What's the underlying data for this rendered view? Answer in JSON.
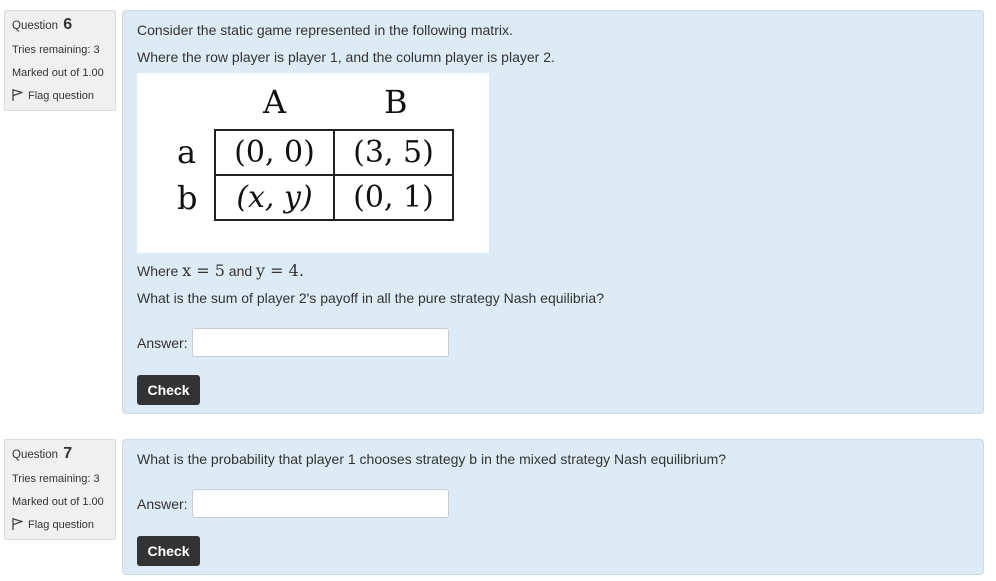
{
  "questions": [
    {
      "label": "Question",
      "number": "6",
      "tries": "Tries remaining: 3",
      "marked": "Marked out of 1.00",
      "flag": "Flag question",
      "intro_1": "Consider the static game represented in the following matrix.",
      "intro_2": "Where the row player is player 1, and the column player is player 2.",
      "matrix": {
        "col_headers": [
          "A",
          "B"
        ],
        "row_headers": [
          "a",
          "b"
        ],
        "cells": [
          [
            "(0, 0)",
            "(3, 5)"
          ],
          [
            "(x, y)",
            "(0, 1)"
          ]
        ]
      },
      "where_prefix": "Where",
      "where_x": "x = 5",
      "where_and": "and",
      "where_y": "y = 4.",
      "prompt": "What is the sum of player 2's payoff in all the pure strategy Nash equilibria?",
      "answer_label": "Answer:",
      "answer_value": "",
      "check_label": "Check"
    },
    {
      "label": "Question",
      "number": "7",
      "tries": "Tries remaining: 3",
      "marked": "Marked out of 1.00",
      "flag": "Flag question",
      "prompt": "What is the probability that player 1 chooses strategy b in the mixed strategy Nash equilibrium?",
      "answer_label": "Answer:",
      "answer_value": "",
      "check_label": "Check"
    }
  ],
  "colors": {
    "content_bg": "#dcebf5",
    "info_bg": "#f0f0f0",
    "button_bg": "#333333"
  }
}
